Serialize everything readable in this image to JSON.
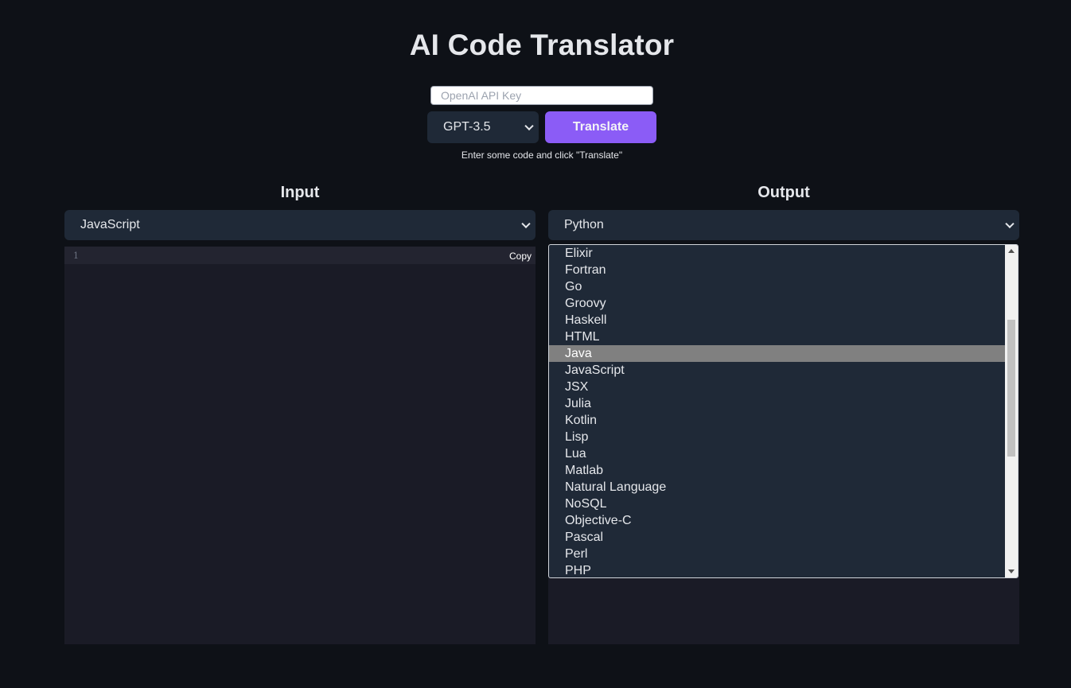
{
  "header": {
    "title": "AI Code Translator"
  },
  "controls": {
    "api_key_placeholder": "OpenAI API Key",
    "api_key_value": "",
    "model": "GPT-3.5",
    "translate_label": "Translate",
    "hint": "Enter some code and click \"Translate\""
  },
  "input": {
    "heading": "Input",
    "language": "JavaScript",
    "line_number": "1",
    "copy_label": "Copy"
  },
  "output": {
    "heading": "Output",
    "language": "Python",
    "dropdown_options": [
      "Elixir",
      "Fortran",
      "Go",
      "Groovy",
      "Haskell",
      "HTML",
      "Java",
      "JavaScript",
      "JSX",
      "Julia",
      "Kotlin",
      "Lisp",
      "Lua",
      "Matlab",
      "Natural Language",
      "NoSQL",
      "Objective-C",
      "Pascal",
      "Perl",
      "PHP"
    ],
    "highlighted_option": "Java"
  },
  "colors": {
    "background": "#0e1117",
    "accent": "#8b5cf6",
    "surface": "#1f2937",
    "editor": "#1a1b26",
    "highlight": "#808080"
  }
}
